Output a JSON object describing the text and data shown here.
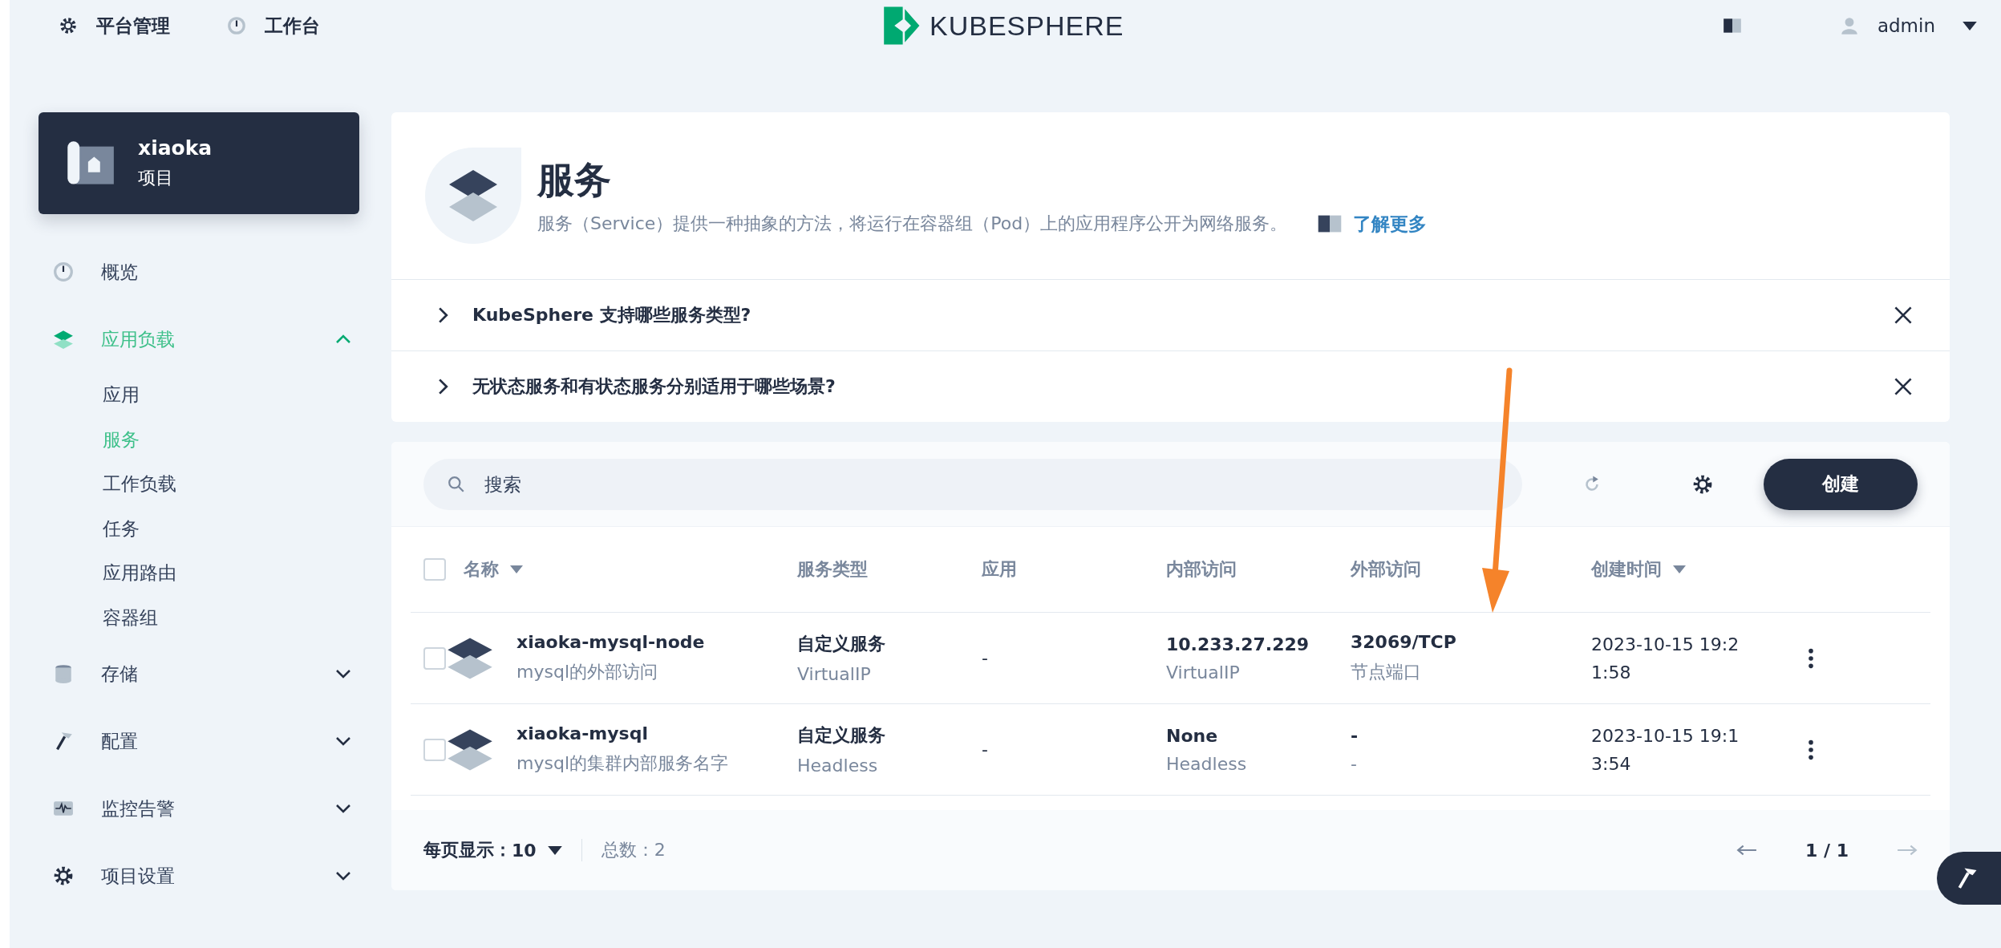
{
  "topbar": {
    "nav": [
      {
        "label": "平台管理"
      },
      {
        "label": "工作台"
      }
    ],
    "logo": "KUBESPHERE",
    "user": "admin"
  },
  "project": {
    "name": "xiaoka",
    "type": "项目"
  },
  "sidebar": {
    "items": [
      {
        "label": "概览",
        "selected": false
      },
      {
        "label": "应用负载",
        "selected": true,
        "expanded": true,
        "children": [
          {
            "label": "应用",
            "selected": false
          },
          {
            "label": "服务",
            "selected": true
          },
          {
            "label": "工作负载",
            "selected": false
          },
          {
            "label": "任务",
            "selected": false
          },
          {
            "label": "应用路由",
            "selected": false
          },
          {
            "label": "容器组",
            "selected": false
          }
        ]
      },
      {
        "label": "存储",
        "selected": false,
        "expanded": false
      },
      {
        "label": "配置",
        "selected": false,
        "expanded": false
      },
      {
        "label": "监控告警",
        "selected": false,
        "expanded": false
      },
      {
        "label": "项目设置",
        "selected": false,
        "expanded": false
      }
    ]
  },
  "banner": {
    "title": "服务",
    "description": "服务（Service）提供一种抽象的方法，将运行在容器组（Pod）上的应用程序公开为网络服务。",
    "link": "了解更多"
  },
  "faq": [
    {
      "question": "KubeSphere 支持哪些服务类型?",
      "expanded": false
    },
    {
      "question": "无状态服务和有状态服务分别适用于哪些场景?",
      "expanded": false
    }
  ],
  "toolbar": {
    "search_placeholder": "搜索",
    "create": "创建"
  },
  "table": {
    "select_all_checked": false,
    "columns": [
      {
        "label": "名称",
        "sortable": true
      },
      {
        "label": "服务类型",
        "sortable": false
      },
      {
        "label": "应用",
        "sortable": false
      },
      {
        "label": "内部访问",
        "sortable": false
      },
      {
        "label": "外部访问",
        "sortable": false
      },
      {
        "label": "创建时间",
        "sortable": true
      }
    ],
    "rows": [
      {
        "checked": false,
        "name": "xiaoka-mysql-node",
        "desc": "mysql的外部访问",
        "type": "自定义服务",
        "type_sub": "VirtualIP",
        "app": "-",
        "internal": "10.233.27.229",
        "internal_sub": "VirtualIP",
        "external": "32069/TCP",
        "external_sub": "节点端口",
        "created": "2023-10-15 19:2",
        "created_2": "1:58"
      },
      {
        "checked": false,
        "name": "xiaoka-mysql",
        "desc": "mysql的集群内部服务名字",
        "type": "自定义服务",
        "type_sub": "Headless",
        "app": "-",
        "internal": "None",
        "internal_sub": "Headless",
        "external": "-",
        "external_sub": "-",
        "created": "2023-10-15 19:1",
        "created_2": "3:54"
      }
    ]
  },
  "footer": {
    "per_page_label": "每页显示：",
    "per_page": "10",
    "total": "总数：2",
    "page": "1 / 1"
  }
}
